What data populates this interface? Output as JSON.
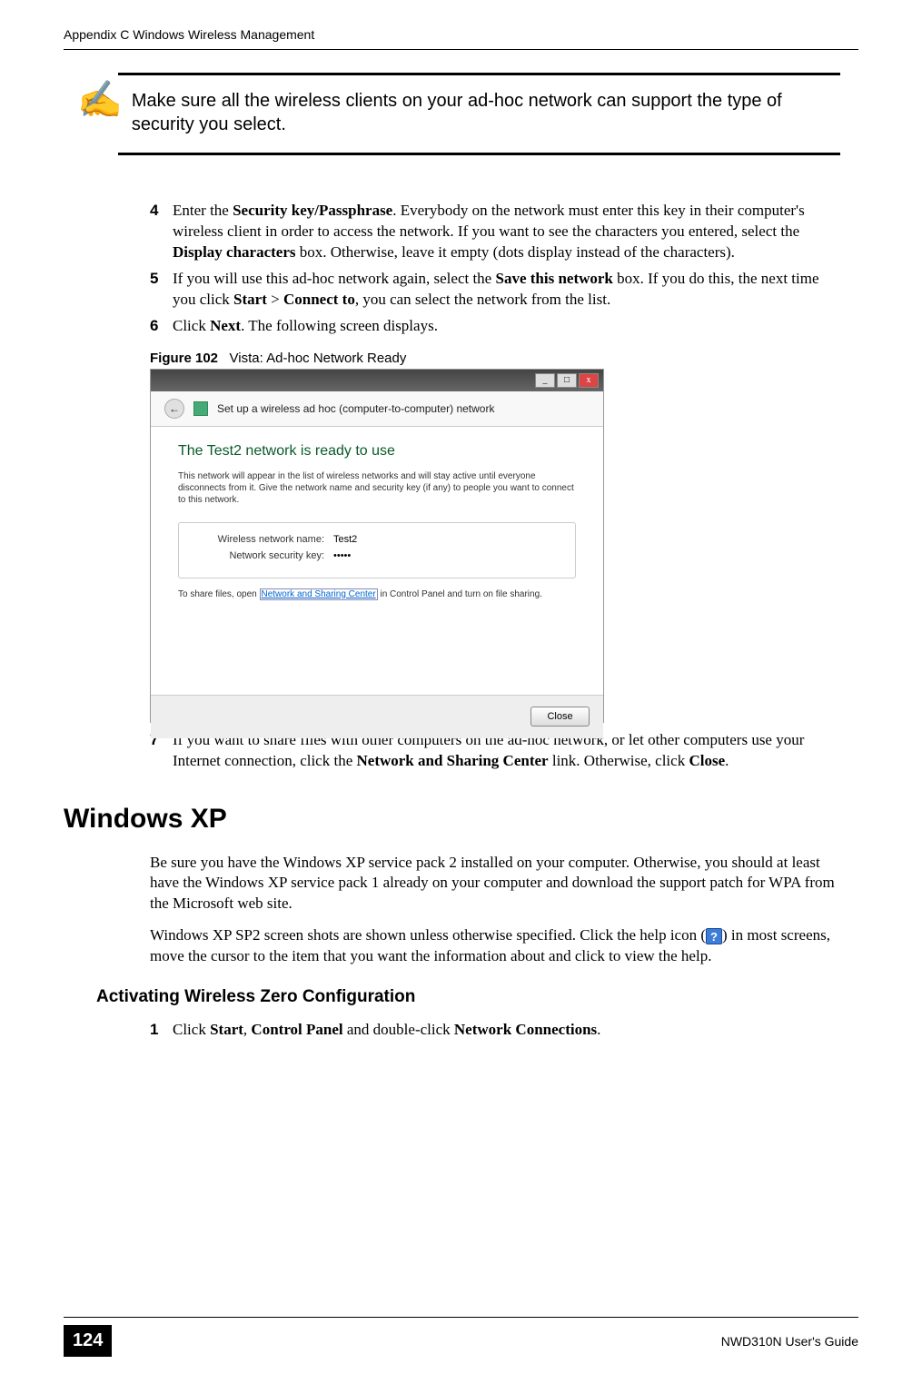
{
  "header": {
    "appendix": "Appendix C Windows Wireless Management"
  },
  "note": {
    "text": "Make sure all the wireless clients on your ad-hoc network can support the type of security you select."
  },
  "steps": {
    "s4": {
      "num": "4",
      "pre": "Enter the ",
      "b1": "Security key/Passphrase",
      "mid1": ". Everybody on the network must enter this key in their computer's wireless client in order to access the network. If you want to see the characters you entered, select the ",
      "b2": "Display characters",
      "post": " box. Otherwise, leave it empty (dots display instead of the characters)."
    },
    "s5": {
      "num": "5",
      "pre": "If you will use this ad-hoc network again, select the ",
      "b1": "Save this network",
      "mid1": " box. If you do this, the next time you click ",
      "b2": "Start",
      "gt": " > ",
      "b3": "Connect to",
      "post": ", you can select the network from the list."
    },
    "s6": {
      "num": "6",
      "pre": "Click ",
      "b1": "Next",
      "post": ". The following screen displays."
    },
    "s7": {
      "num": "7",
      "pre": "If you want to share files with other computers on the ad-hoc network, or let other computers use your Internet connection, click the ",
      "b1": "Network and Sharing Center",
      "mid1": " link. Otherwise, click ",
      "b2": "Close",
      "post": "."
    },
    "xp1": {
      "num": "1",
      "pre": "Click ",
      "b1": "Start",
      "c1": ", ",
      "b2": "Control Panel",
      "mid": " and double-click ",
      "b3": "Network Connections",
      "post": "."
    }
  },
  "figure": {
    "caption_prefix": "Figure 102",
    "caption_text": "Vista: Ad-hoc Network Ready",
    "subhead": "Set up a wireless ad hoc (computer-to-computer) network",
    "ready_title": "The Test2 network is ready to use",
    "ready_desc": "This network will appear in the list of wireless networks and will stay active until everyone disconnects from it. Give the network name and security key (if any) to people you want to connect to this network.",
    "name_label": "Wireless network name:",
    "name_value": "Test2",
    "key_label": "Network security key:",
    "key_value": "•••••",
    "share_pre": "To share files, open ",
    "share_link": "Network and Sharing Center",
    "share_post": " in Control Panel and turn on file sharing.",
    "close_btn": "Close"
  },
  "xp": {
    "heading": "Windows XP",
    "para1": "Be sure you have the Windows XP service pack 2 installed on your computer. Otherwise, you should at least have the Windows XP service pack 1 already on your computer and download the support patch for WPA from the Microsoft web site.",
    "para2_pre": "Windows XP SP2 screen shots are shown unless otherwise specified. Click the help icon (",
    "para2_post": ") in most screens, move the cursor to the item that you want the information about and click to view the help.",
    "subheading": "Activating Wireless Zero Configuration"
  },
  "footer": {
    "page": "124",
    "guide": "NWD310N User's Guide"
  }
}
